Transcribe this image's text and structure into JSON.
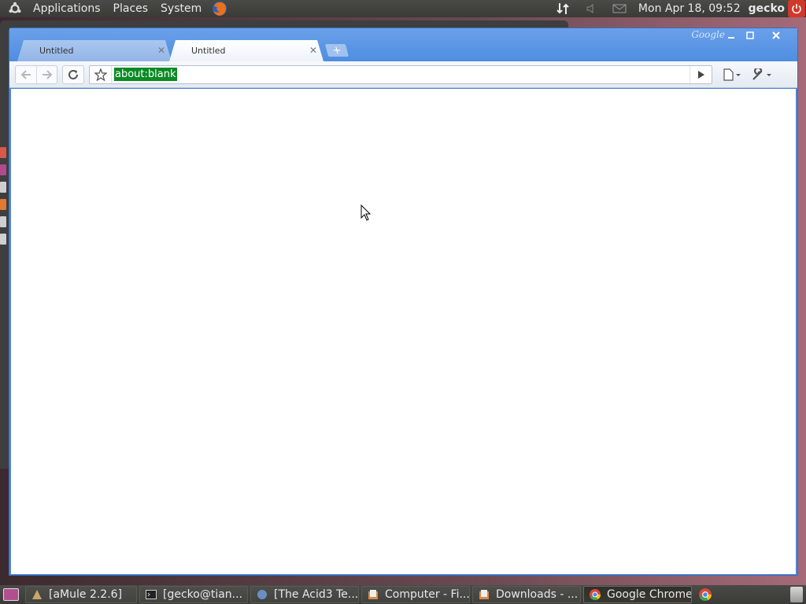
{
  "top_panel": {
    "menus": [
      "Applications",
      "Places",
      "System"
    ],
    "clock": "Mon Apr 18, 09:52",
    "user": "gecko"
  },
  "browser": {
    "brand_label": "Google",
    "tabs": [
      {
        "title": "Untitled",
        "active": false
      },
      {
        "title": "Untitled",
        "active": true
      }
    ],
    "url": "about:blank"
  },
  "taskbar": {
    "tasks": [
      {
        "label": "[aMule 2.2.6]",
        "icon": "amule-icon"
      },
      {
        "label": "[gecko@tian...",
        "icon": "terminal-icon"
      },
      {
        "label": "[The Acid3 Te...",
        "icon": "globe-icon"
      },
      {
        "label": "Computer - Fi...",
        "icon": "folder-icon"
      },
      {
        "label": "Downloads - ...",
        "icon": "folder-icon"
      },
      {
        "label": "Google Chrome",
        "icon": "chrome-icon"
      }
    ]
  },
  "colors": {
    "panel": "#3f3f3b",
    "chrome_frame": "#4f8ee0",
    "url_highlight": "#0a8a24"
  }
}
